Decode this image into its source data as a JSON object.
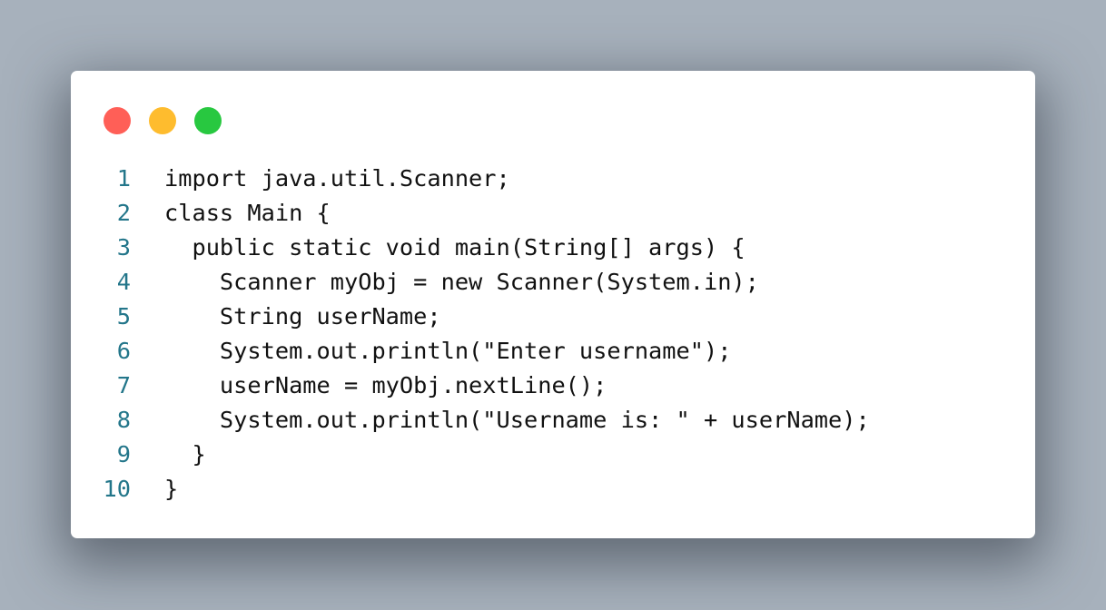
{
  "window_controls": {
    "close_color": "#ff5f57",
    "minimize_color": "#febc2e",
    "maximize_color": "#28c840"
  },
  "code": {
    "lines": [
      {
        "n": "1",
        "text": "import java.util.Scanner;"
      },
      {
        "n": "2",
        "text": "class Main {"
      },
      {
        "n": "3",
        "text": "  public static void main(String[] args) {"
      },
      {
        "n": "4",
        "text": "    Scanner myObj = new Scanner(System.in);"
      },
      {
        "n": "5",
        "text": "    String userName;"
      },
      {
        "n": "6",
        "text": "    System.out.println(\"Enter username\");"
      },
      {
        "n": "7",
        "text": "    userName = myObj.nextLine();"
      },
      {
        "n": "8",
        "text": "    System.out.println(\"Username is: \" + userName);"
      },
      {
        "n": "9",
        "text": "  }"
      },
      {
        "n": "10",
        "text": "}"
      }
    ]
  }
}
